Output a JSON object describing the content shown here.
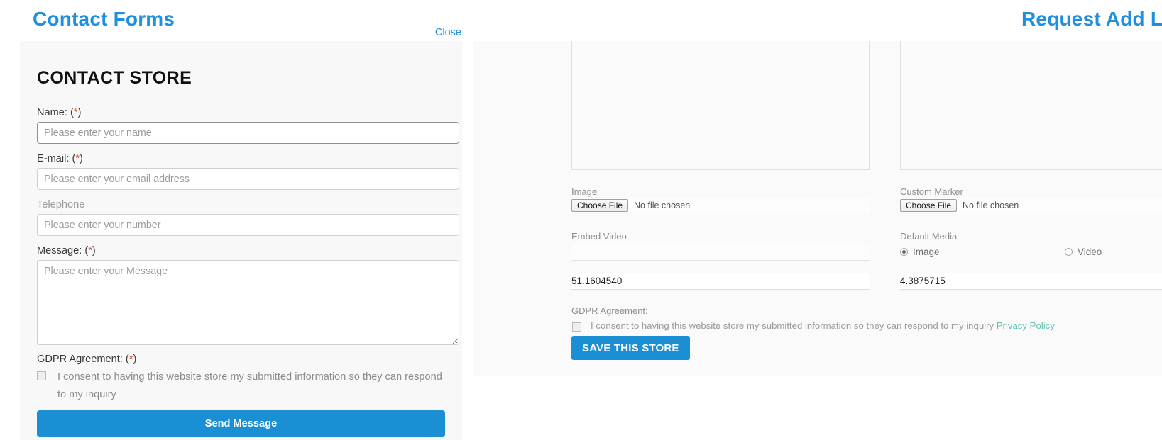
{
  "left_panel": {
    "heading": "Contact Forms",
    "close_label": "Close",
    "card_title": "CONTACT STORE",
    "fields": [
      {
        "label": "Name:",
        "required": true,
        "placeholder": "Please enter your name",
        "value": ""
      },
      {
        "label": "E-mail:",
        "required": true,
        "placeholder": "Please enter your email address",
        "value": ""
      },
      {
        "label": "Telephone",
        "required": false,
        "placeholder": "Please enter your number",
        "value": ""
      }
    ],
    "message": {
      "label": "Message:",
      "required": true,
      "placeholder": "Please enter your Message",
      "value": ""
    },
    "gdpr": {
      "label": "GDPR Agreement:",
      "required": true,
      "consent_text": "I consent to having this website store my submitted information so they can respond to my inquiry",
      "checked": false
    },
    "submit_label": "Send Message",
    "required_marker": "(*)"
  },
  "right_panel": {
    "heading": "Request Add Locations Form",
    "image_field": {
      "label": "Image",
      "button_label": "Choose File",
      "status": "No file chosen"
    },
    "marker_field": {
      "label": "Custom Marker",
      "button_label": "Choose File",
      "status": "No file chosen"
    },
    "embed_video": {
      "label": "Embed Video",
      "value": ""
    },
    "default_media": {
      "label": "Default Media",
      "options": [
        {
          "label": "Image",
          "selected": true
        },
        {
          "label": "Video",
          "selected": false
        }
      ]
    },
    "coordinates": {
      "latitude": "51.1604540",
      "longitude": "4.3875715"
    },
    "gdpr": {
      "label": "GDPR Agreement:",
      "consent_text": "I consent to having this website store my submitted information so they can respond to my inquiry",
      "privacy_link_label": "Privacy Policy",
      "checked": false
    },
    "save_label": "SAVE THIS STORE"
  },
  "colors": {
    "heading_blue": "#1e8fe1",
    "button_blue": "#1b8fd4",
    "required_red": "#e8503a",
    "privacy_green": "#62c2ae",
    "card_gray": "#f8f8f8"
  }
}
